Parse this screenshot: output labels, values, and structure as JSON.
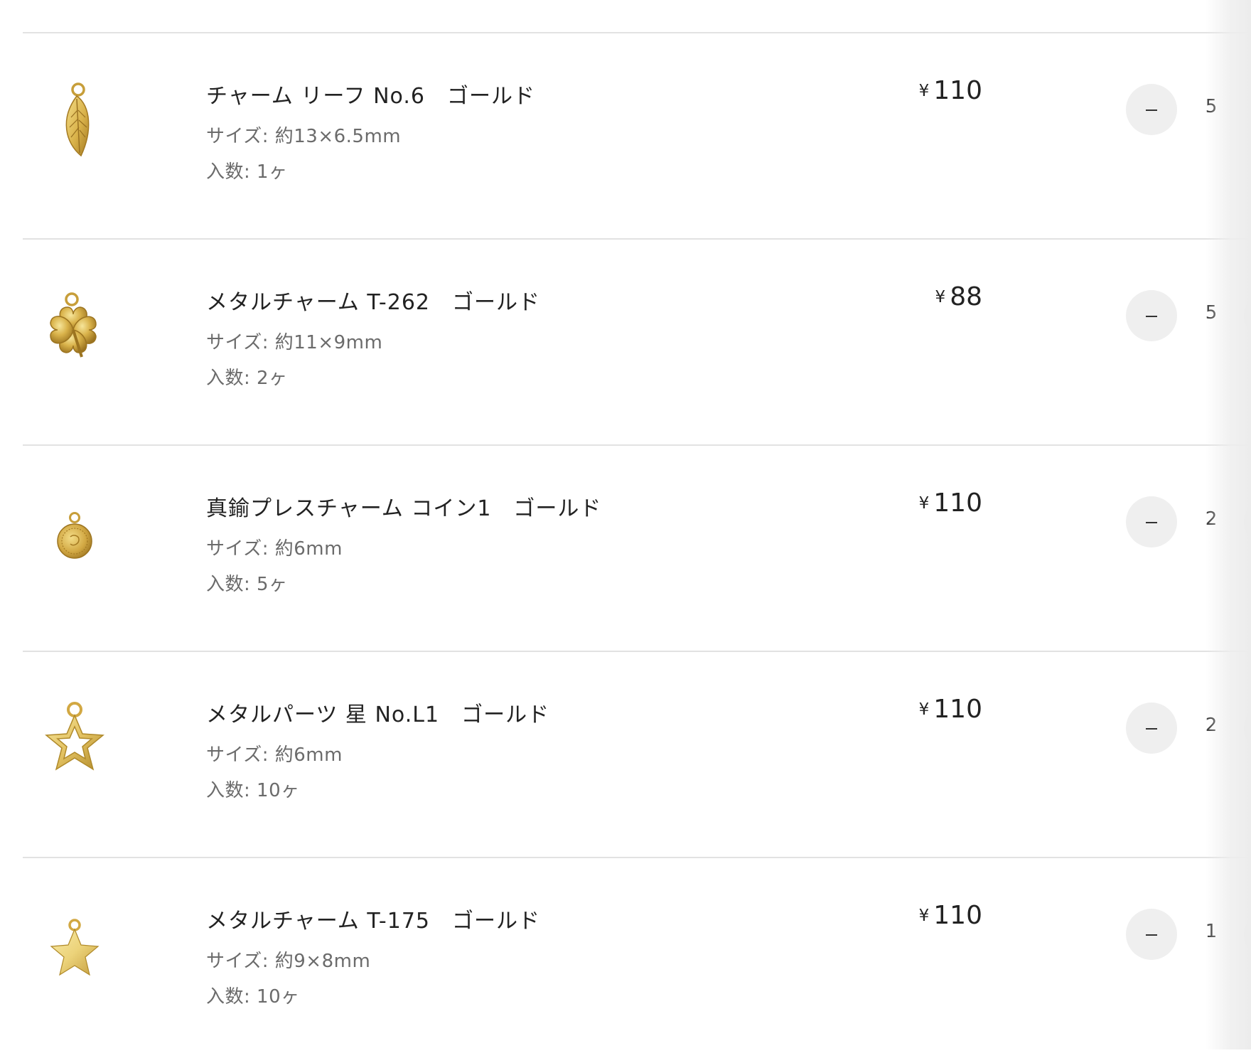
{
  "cart": {
    "items": [
      {
        "name": "チャーム リーフ No.6　ゴールド",
        "size": "サイズ: 約13×6.5mm",
        "count": "入数: 1ヶ",
        "currency": "¥",
        "price": "110",
        "quantity": "5",
        "icon": "leaf-charm-icon"
      },
      {
        "name": "メタルチャーム T-262　ゴールド",
        "size": "サイズ: 約11×9mm",
        "count": "入数: 2ヶ",
        "currency": "¥",
        "price": "88",
        "quantity": "5",
        "icon": "clover-charm-icon"
      },
      {
        "name": "真鍮プレスチャーム コイン1　ゴールド",
        "size": "サイズ: 約6mm",
        "count": "入数: 5ヶ",
        "currency": "¥",
        "price": "110",
        "quantity": "2",
        "icon": "coin-charm-icon"
      },
      {
        "name": "メタルパーツ 星 No.L1　ゴールド",
        "size": "サイズ: 約6mm",
        "count": "入数: 10ヶ",
        "currency": "¥",
        "price": "110",
        "quantity": "2",
        "icon": "hollow-star-charm-icon"
      },
      {
        "name": "メタルチャーム T-175　ゴールド",
        "size": "サイズ: 約9×8mm",
        "count": "入数: 10ヶ",
        "currency": "¥",
        "price": "110",
        "quantity": "1",
        "icon": "solid-star-charm-icon"
      }
    ]
  },
  "colors": {
    "gold": "#d9b24a",
    "gold_dark": "#b08a2a",
    "gold_light": "#f3dc86",
    "divider": "#e2e2e2",
    "button_bg": "#efefef"
  }
}
